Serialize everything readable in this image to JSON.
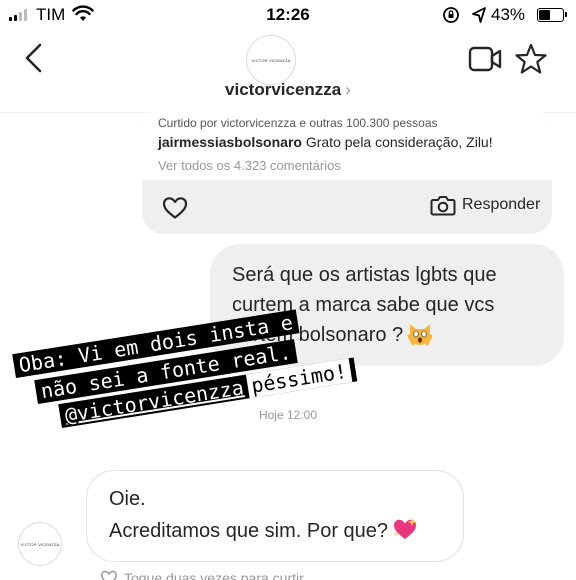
{
  "status_bar": {
    "carrier": "TIM",
    "time": "12:26",
    "battery_percent_label": "43%",
    "battery_level": 0.43
  },
  "header": {
    "avatar_text": "VICTOR VICENZZA",
    "username": "victorvicenzza",
    "chevron": "›"
  },
  "shared_post": {
    "liked_by": "Curtido por victorvicenzza e outras 100.300 pessoas",
    "caption_user": "jairmessiasbolsonaro",
    "caption_text": " Grato pela consideração, Zilu!",
    "view_comments": "Ver todos os 4.323 comentários",
    "reply_label": "Responder"
  },
  "messages": {
    "sent_text": "Será que os artistas lgbts que curtem  a marca sabe que vcs curtem bolsonaro ?",
    "timestamp": "Hoje 12:00",
    "received_line1": "Oie.",
    "received_line2": "Acreditamos que sim. Por que?",
    "received_avatar_text": "VICTOR VICENZZA",
    "bottom_hint": "Toque duas vezes para curtir"
  },
  "overlay": {
    "line1": "Oba: Vi em dois insta e",
    "line2": "não sei a fonte real.",
    "handle": "@victorvicenzza",
    "reaction": "péssimo!"
  },
  "icons": [
    "signal-icon",
    "wifi-icon",
    "rotation-lock-icon",
    "location-arrow-icon",
    "battery-icon",
    "back-chevron-icon",
    "video-camera-icon",
    "star-icon",
    "heart-outline-icon",
    "camera-icon",
    "scream-cat-emoji",
    "sparkling-heart-emoji"
  ]
}
